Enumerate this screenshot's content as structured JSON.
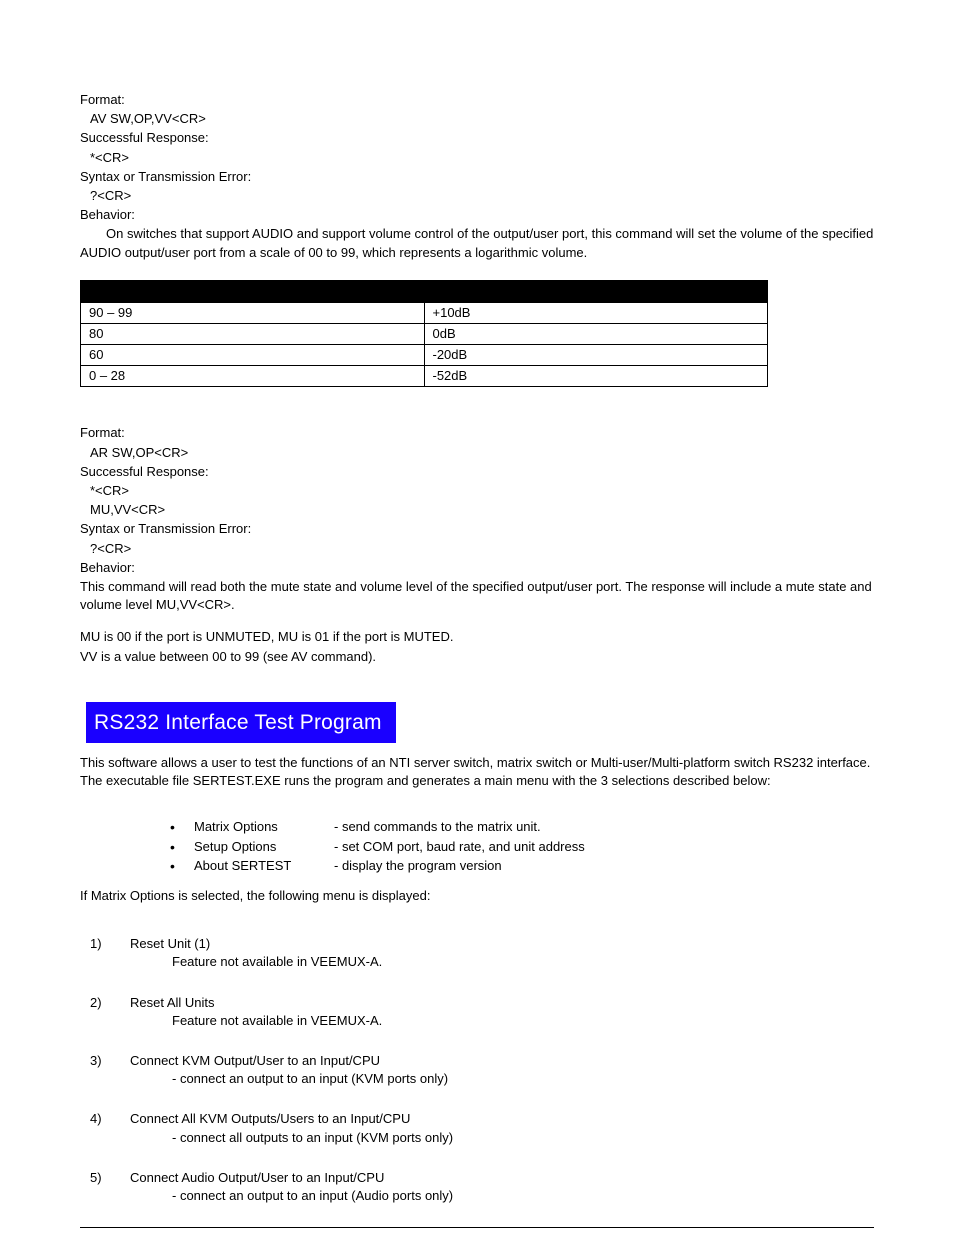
{
  "section1": {
    "formatLabel": "Format:",
    "formatLine": "AV SW,OP,VV<CR>",
    "successLabel": "Successful Response:",
    "successLine": "*<CR>",
    "errorLabel": "Syntax or Transmission Error:",
    "errorLine": "?<CR>",
    "behaviorLabel": "Behavior:",
    "behaviorText": "On switches that support AUDIO and support volume control of the output/user port, this command will set the volume of the specified AUDIO output/user port from a scale of 00 to 99, which represents a logarithmic volume."
  },
  "dbTable": {
    "header": {
      "a": "",
      "b": ""
    },
    "rows": [
      {
        "a": "90 – 99",
        "b": "+10dB"
      },
      {
        "a": "80",
        "b": "0dB"
      },
      {
        "a": "60",
        "b": "-20dB"
      },
      {
        "a": "0 – 28",
        "b": "-52dB"
      }
    ]
  },
  "section2": {
    "formatLabel": "Format:",
    "formatLine": "AR SW,OP<CR>",
    "successLabel": "Successful Response:",
    "successLine1": "*<CR>",
    "successLine2": "MU,VV<CR>",
    "errorLabel": "Syntax or Transmission Error:",
    "errorLine": "?<CR>",
    "behaviorLabel": "Behavior:",
    "behaviorText": "This command will read both the mute state and volume level of the specified output/user port.  The response will include a mute state and volume level MU,VV<CR>.",
    "muLine": "MU is 00 if the port is UNMUTED, MU is 01 if the port is MUTED.",
    "vvLine": "VV is a value between 00 to 99 (see AV command)."
  },
  "rsHeading": "RS232 Interface Test  Program",
  "rsPara": "This software allows a user to test the functions of an NTI server switch, matrix switch or Multi-user/Multi-platform switch RS232 interface.  The executable file SERTEST.EXE runs the program and generates a main menu with the 3 selections described below:",
  "mainMenu": [
    {
      "label": "Matrix Options",
      "desc": "- send commands to the matrix unit."
    },
    {
      "label": "Setup Options",
      "desc": "- set COM port, baud rate, and unit address"
    },
    {
      "label": "About SERTEST",
      "desc": "- display the program version"
    }
  ],
  "matrixIntro": "If Matrix Options is selected, the following menu is displayed:",
  "matrixList": [
    {
      "num": "1)",
      "title": "Reset Unit (1)",
      "sub": "Feature not available in VEEMUX-A."
    },
    {
      "num": "2)",
      "title": "Reset All Units",
      "sub": "Feature not available in VEEMUX-A."
    },
    {
      "num": "3)",
      "title": "Connect KVM Output/User to an Input/CPU",
      "sub": "- connect an output to an input (KVM ports only)"
    },
    {
      "num": "4)",
      "title": "Connect All KVM Outputs/Users to an Input/CPU",
      "sub": "- connect all outputs to an input (KVM ports only)"
    },
    {
      "num": "5)",
      "title": "Connect Audio Output/User to an Input/CPU",
      "sub": "- connect an output to an input (Audio ports only)"
    }
  ]
}
